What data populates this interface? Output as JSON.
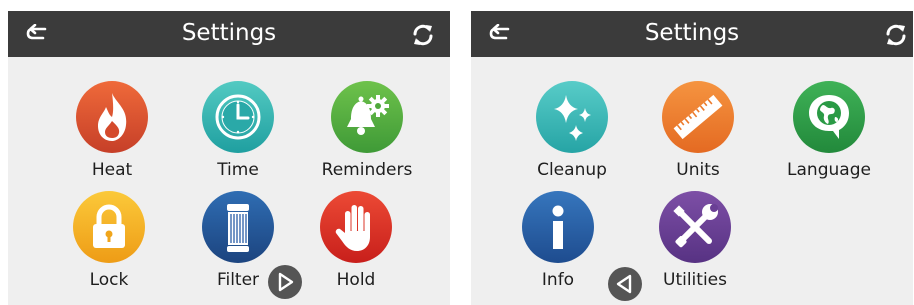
{
  "screens": [
    {
      "title": "Settings",
      "back_icon": "back-arrow-icon",
      "refresh_icon": "refresh-icon",
      "tiles": [
        {
          "label": "Heat",
          "icon": "flame-icon",
          "color": "#e0532f"
        },
        {
          "label": "Time",
          "icon": "clock-icon",
          "color": "#33b8b4"
        },
        {
          "label": "Reminders",
          "icon": "bell-gear-icon",
          "color": "#5cae3f"
        },
        {
          "label": "Lock",
          "icon": "padlock-icon",
          "color": "#f5b21d"
        },
        {
          "label": "Filter",
          "icon": "filter-cartridge-icon",
          "color": "#24589c"
        },
        {
          "label": "Hold",
          "icon": "hand-stop-icon",
          "color": "#df3022"
        }
      ],
      "next_icon": "next-page-icon"
    },
    {
      "title": "Settings",
      "back_icon": "back-arrow-icon",
      "refresh_icon": "refresh-icon",
      "tiles": [
        {
          "label": "Cleanup",
          "icon": "sparkle-icon",
          "color": "#3cbdbb"
        },
        {
          "label": "Units",
          "icon": "ruler-icon",
          "color": "#ef7d2d"
        },
        {
          "label": "Language",
          "icon": "globe-speech-icon",
          "color": "#2fa04a"
        },
        {
          "label": "Info",
          "icon": "info-icon",
          "color": "#2a5ea8"
        },
        {
          "label": "Utilities",
          "icon": "tools-icon",
          "color": "#6b3f93"
        }
      ],
      "prev_icon": "previous-page-icon"
    }
  ],
  "colors": {
    "header_background": "#3b3b3b",
    "screen_background": "#efefef",
    "nav_arrow": "#555555"
  }
}
